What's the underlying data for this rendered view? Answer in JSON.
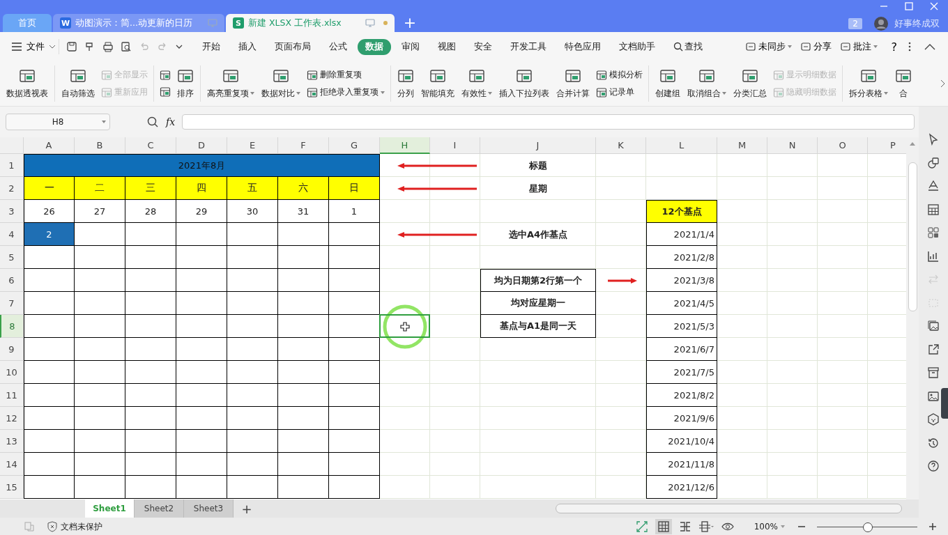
{
  "title_bar": {
    "tabs": [
      {
        "kind": "home",
        "label": "首页",
        "selected": false
      },
      {
        "kind": "writer",
        "app_letter": "W",
        "label": "动图演示：简...动更新的日历",
        "selected": false
      },
      {
        "kind": "sheet",
        "app_letter": "S",
        "label": "新建 XLSX 工作表.xlsx",
        "selected": true
      }
    ],
    "new_tab": "+",
    "badge": "2",
    "user": "好事终成双"
  },
  "menu_bar": {
    "file": "文件",
    "tabs": [
      {
        "label": "开始",
        "selected": false
      },
      {
        "label": "插入",
        "selected": false
      },
      {
        "label": "页面布局",
        "selected": false
      },
      {
        "label": "公式",
        "selected": false
      },
      {
        "label": "数据",
        "selected": true
      },
      {
        "label": "审阅",
        "selected": false
      },
      {
        "label": "视图",
        "selected": false
      },
      {
        "label": "安全",
        "selected": false
      },
      {
        "label": "开发工具",
        "selected": false
      },
      {
        "label": "特色应用",
        "selected": false
      },
      {
        "label": "文档助手",
        "selected": false
      }
    ],
    "search": "查找",
    "actions": [
      {
        "label": "未同步",
        "dropdown": true
      },
      {
        "label": "分享",
        "dropdown": false
      },
      {
        "label": "批注",
        "dropdown": true
      }
    ],
    "help": "?"
  },
  "ribbon": [
    {
      "kind": "big",
      "label": "数据透视表",
      "dropdown": false,
      "disabled": false
    },
    {
      "kind": "divider"
    },
    {
      "kind": "big",
      "label": "自动筛选",
      "dropdown": false,
      "disabled": false
    },
    {
      "kind": "stack",
      "items": [
        {
          "label": "全部显示",
          "dropdown": false,
          "disabled": true
        },
        {
          "label": "重新应用",
          "dropdown": false,
          "disabled": true
        }
      ]
    },
    {
      "kind": "divider"
    },
    {
      "kind": "stack",
      "items": [
        {
          "dropdown": false,
          "disabled": false
        },
        {
          "dropdown": false,
          "disabled": false
        }
      ]
    },
    {
      "kind": "big",
      "label": "排序",
      "dropdown": false,
      "disabled": false
    },
    {
      "kind": "divider"
    },
    {
      "kind": "big",
      "label": "高亮重复项",
      "dropdown": true,
      "disabled": false
    },
    {
      "kind": "big",
      "label": "数据对比",
      "dropdown": true,
      "disabled": false
    },
    {
      "kind": "stack",
      "items": [
        {
          "label": "删除重复项",
          "dropdown": false,
          "disabled": false
        },
        {
          "label": "拒绝录入重复项",
          "dropdown": true,
          "disabled": false
        }
      ]
    },
    {
      "kind": "divider"
    },
    {
      "kind": "big",
      "label": "分列",
      "dropdown": false,
      "disabled": false
    },
    {
      "kind": "big",
      "label": "智能填充",
      "dropdown": false,
      "disabled": false
    },
    {
      "kind": "big",
      "label": "有效性",
      "dropdown": true,
      "disabled": false
    },
    {
      "kind": "big",
      "label": "插入下拉列表",
      "dropdown": false,
      "disabled": false
    },
    {
      "kind": "big",
      "label": "合并计算",
      "dropdown": false,
      "disabled": false
    },
    {
      "kind": "stack",
      "items": [
        {
          "label": "模拟分析",
          "dropdown": false,
          "disabled": false
        },
        {
          "label": "记录单",
          "dropdown": false,
          "disabled": false
        }
      ]
    },
    {
      "kind": "divider"
    },
    {
      "kind": "big",
      "label": "创建组",
      "dropdown": false,
      "disabled": false
    },
    {
      "kind": "big",
      "label": "取消组合",
      "dropdown": true,
      "disabled": false
    },
    {
      "kind": "big",
      "label": "分类汇总",
      "dropdown": false,
      "disabled": false
    },
    {
      "kind": "stack",
      "items": [
        {
          "label": "显示明细数据",
          "dropdown": false,
          "disabled": true
        },
        {
          "label": "隐藏明细数据",
          "dropdown": false,
          "disabled": true
        }
      ]
    },
    {
      "kind": "divider"
    },
    {
      "kind": "big",
      "label": "拆分表格",
      "dropdown": true,
      "disabled": false
    },
    {
      "kind": "big",
      "label": "合",
      "dropdown": false,
      "disabled": false
    }
  ],
  "formula_bar": {
    "name_box": "H8",
    "fx": "fx"
  },
  "sheet": {
    "columns": [
      {
        "label": "A",
        "selected": false
      },
      {
        "label": "B",
        "selected": false
      },
      {
        "label": "C",
        "selected": false
      },
      {
        "label": "D",
        "selected": false
      },
      {
        "label": "E",
        "selected": false
      },
      {
        "label": "F",
        "selected": false
      },
      {
        "label": "G",
        "selected": false
      },
      {
        "label": "H",
        "selected": true
      },
      {
        "label": "I",
        "selected": false
      },
      {
        "label": "J",
        "selected": false
      },
      {
        "label": "K",
        "selected": false
      },
      {
        "label": "L",
        "selected": false
      },
      {
        "label": "M",
        "selected": false
      },
      {
        "label": "N",
        "selected": false
      },
      {
        "label": "O",
        "selected": false
      },
      {
        "label": "P",
        "selected": false
      }
    ],
    "rows": [
      {
        "label": "1",
        "selected": false
      },
      {
        "label": "2",
        "selected": false
      },
      {
        "label": "3",
        "selected": false
      },
      {
        "label": "4",
        "selected": false
      },
      {
        "label": "5",
        "selected": false
      },
      {
        "label": "6",
        "selected": false
      },
      {
        "label": "7",
        "selected": false
      },
      {
        "label": "8",
        "selected": true
      },
      {
        "label": "9",
        "selected": false
      },
      {
        "label": "10",
        "selected": false
      },
      {
        "label": "11",
        "selected": false
      },
      {
        "label": "12",
        "selected": false
      },
      {
        "label": "13",
        "selected": false
      },
      {
        "label": "14",
        "selected": false
      },
      {
        "label": "15",
        "selected": false
      }
    ],
    "calendar": {
      "title": "2021年8月",
      "weekdays": [
        "一",
        "二",
        "三",
        "四",
        "五",
        "六",
        "日"
      ],
      "weeks": [
        [
          {
            "text": "26",
            "selected": false
          },
          {
            "text": "27",
            "selected": false
          },
          {
            "text": "28",
            "selected": false
          },
          {
            "text": "29",
            "selected": false
          },
          {
            "text": "30",
            "selected": false
          },
          {
            "text": "31",
            "selected": false
          },
          {
            "text": "1",
            "selected": false
          }
        ],
        [
          {
            "text": "2",
            "selected": true
          }
        ]
      ]
    },
    "notes": [
      {
        "kind": "arrow",
        "text": "标题"
      },
      {
        "kind": "arrow",
        "text": "星期"
      },
      {
        "kind": "blank"
      },
      {
        "kind": "arrow",
        "text": "选中A4作基点"
      },
      {
        "kind": "blank"
      },
      {
        "kind": "boxed_arrow",
        "text": "均为日期第2行第一个"
      },
      {
        "kind": "boxed",
        "text": "均对应星期一"
      },
      {
        "kind": "boxed",
        "text": "基点与A1是同一天"
      }
    ],
    "base_points": {
      "header": "12个基点",
      "dates": [
        "2021/1/4",
        "2021/2/8",
        "2021/3/8",
        "2021/4/5",
        "2021/5/3",
        "2021/6/7",
        "2021/7/5",
        "2021/8/2",
        "2021/9/6",
        "2021/10/4",
        "2021/11/8",
        "2021/12/6"
      ]
    }
  },
  "sheet_tabs": [
    {
      "label": "Sheet1",
      "selected": true
    },
    {
      "label": "Sheet2",
      "selected": false
    },
    {
      "label": "Sheet3",
      "selected": false
    }
  ],
  "add_sheet": "+",
  "status_bar": {
    "protection": "文档未保护",
    "zoom": "100%",
    "zoom_slider": {
      "level": 0.5
    }
  }
}
